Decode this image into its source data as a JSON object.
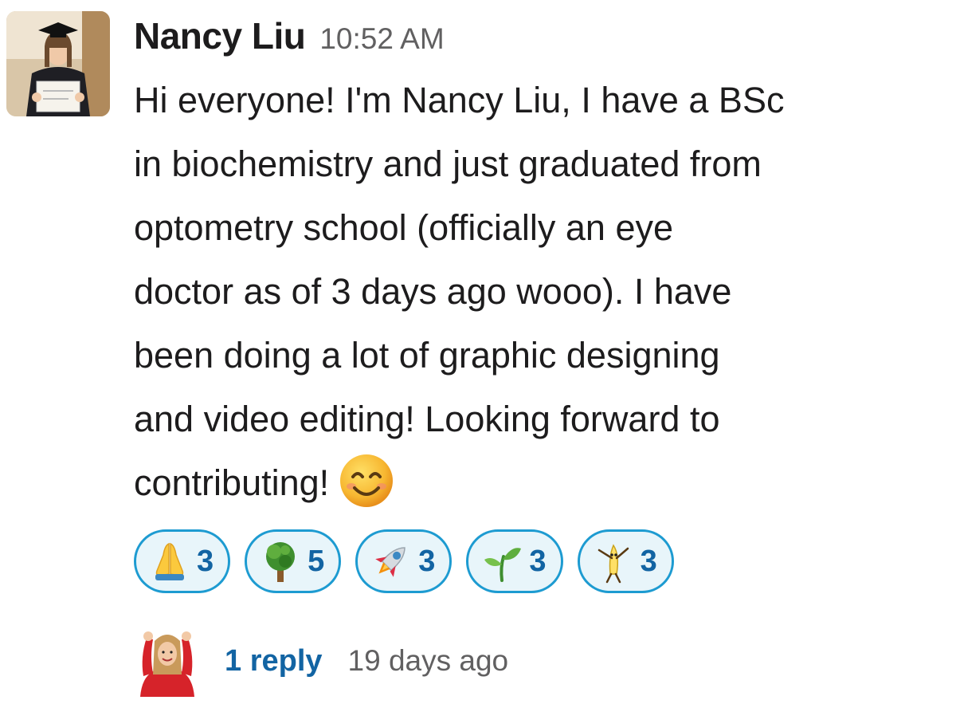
{
  "message": {
    "sender": "Nancy Liu",
    "timestamp": "10:52 AM",
    "text_lines": [
      "Hi everyone! I'm Nancy Liu, I have a BSc",
      "in biochemistry and just graduated from",
      "optometry school (officially an eye",
      "doctor as of 3 days ago wooo). I have",
      "been doing a lot of graphic designing",
      "and video editing! Looking forward to",
      "contributing!"
    ],
    "trailing_emoji": "smiling-face-with-smiling-eyes"
  },
  "reactions": [
    {
      "emoji": "folded-hands",
      "count": "3"
    },
    {
      "emoji": "deciduous-tree",
      "count": "5"
    },
    {
      "emoji": "rocket",
      "count": "3"
    },
    {
      "emoji": "seedling",
      "count": "3"
    },
    {
      "emoji": "dancing-banana",
      "count": "3"
    }
  ],
  "thread": {
    "reply_label": "1 reply",
    "last_reply": "19 days ago"
  },
  "colors": {
    "reaction_border": "#1d9bd1",
    "reaction_bg": "#e8f5fa",
    "link": "#1264a3",
    "muted": "#616061"
  }
}
